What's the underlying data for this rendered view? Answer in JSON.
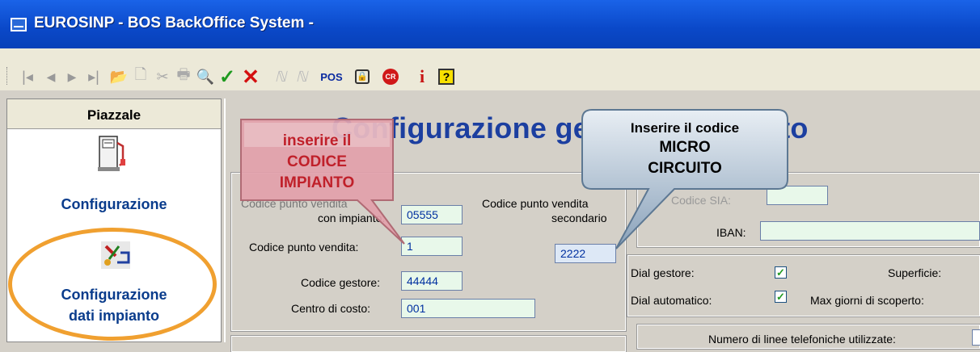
{
  "window": {
    "title": "EUROSINP - BOS BackOffice System -"
  },
  "toolbar": {
    "pos_label": "POS",
    "cr_label": "CR",
    "info_label": "i",
    "help_label": "?"
  },
  "sidebar": {
    "header": "Piazzale",
    "items": [
      {
        "label": "Configurazione"
      },
      {
        "label_line1": "Configurazione",
        "label_line2": "dati impianto"
      }
    ]
  },
  "main": {
    "title": "Configurazione generale impianto",
    "form": {
      "codice_pv_impianto_label_line1": "Codice punto vendita",
      "codice_pv_impianto_label_line2": "con impianto:",
      "codice_pv_impianto_value": "05555",
      "codice_pv_secondario_label_line1": "Codice punto vendita",
      "codice_pv_secondario_label_line2": "secondario",
      "codice_pv_secondario_value": "2222",
      "codice_pv_label": "Codice punto vendita:",
      "codice_pv_value": "1",
      "codice_gestore_label": "Codice gestore:",
      "codice_gestore_value": "44444",
      "centro_costo_label": "Centro di costo:",
      "centro_costo_value": "001",
      "codice_sia_label": "Codice SIA:",
      "codice_sia_value": "",
      "iban_label": "IBAN:",
      "iban_value": "",
      "dial_gestore_label": "Dial gestore:",
      "dial_gestore_checked": true,
      "superficie_label": "Superficie:",
      "dial_automatico_label": "Dial automatico:",
      "dial_automatico_checked": true,
      "max_giorni_label": "Max giorni di scoperto:",
      "numero_linee_label": "Numero di linee telefoniche utilizzate:"
    }
  },
  "callouts": {
    "codice_impianto": {
      "line1": "inserire il",
      "line2": "CODICE",
      "line3": "IMPIANTO"
    },
    "micro_circuito": {
      "line1": "Inserire il codice",
      "line2": "MICRO",
      "line3": "CIRCUITO"
    }
  },
  "colors": {
    "title_bar": "#0a48c8",
    "callout_red_text": "#c0202a",
    "callout_highlight": "#f0a030",
    "title_blue": "#1c3fa0"
  }
}
